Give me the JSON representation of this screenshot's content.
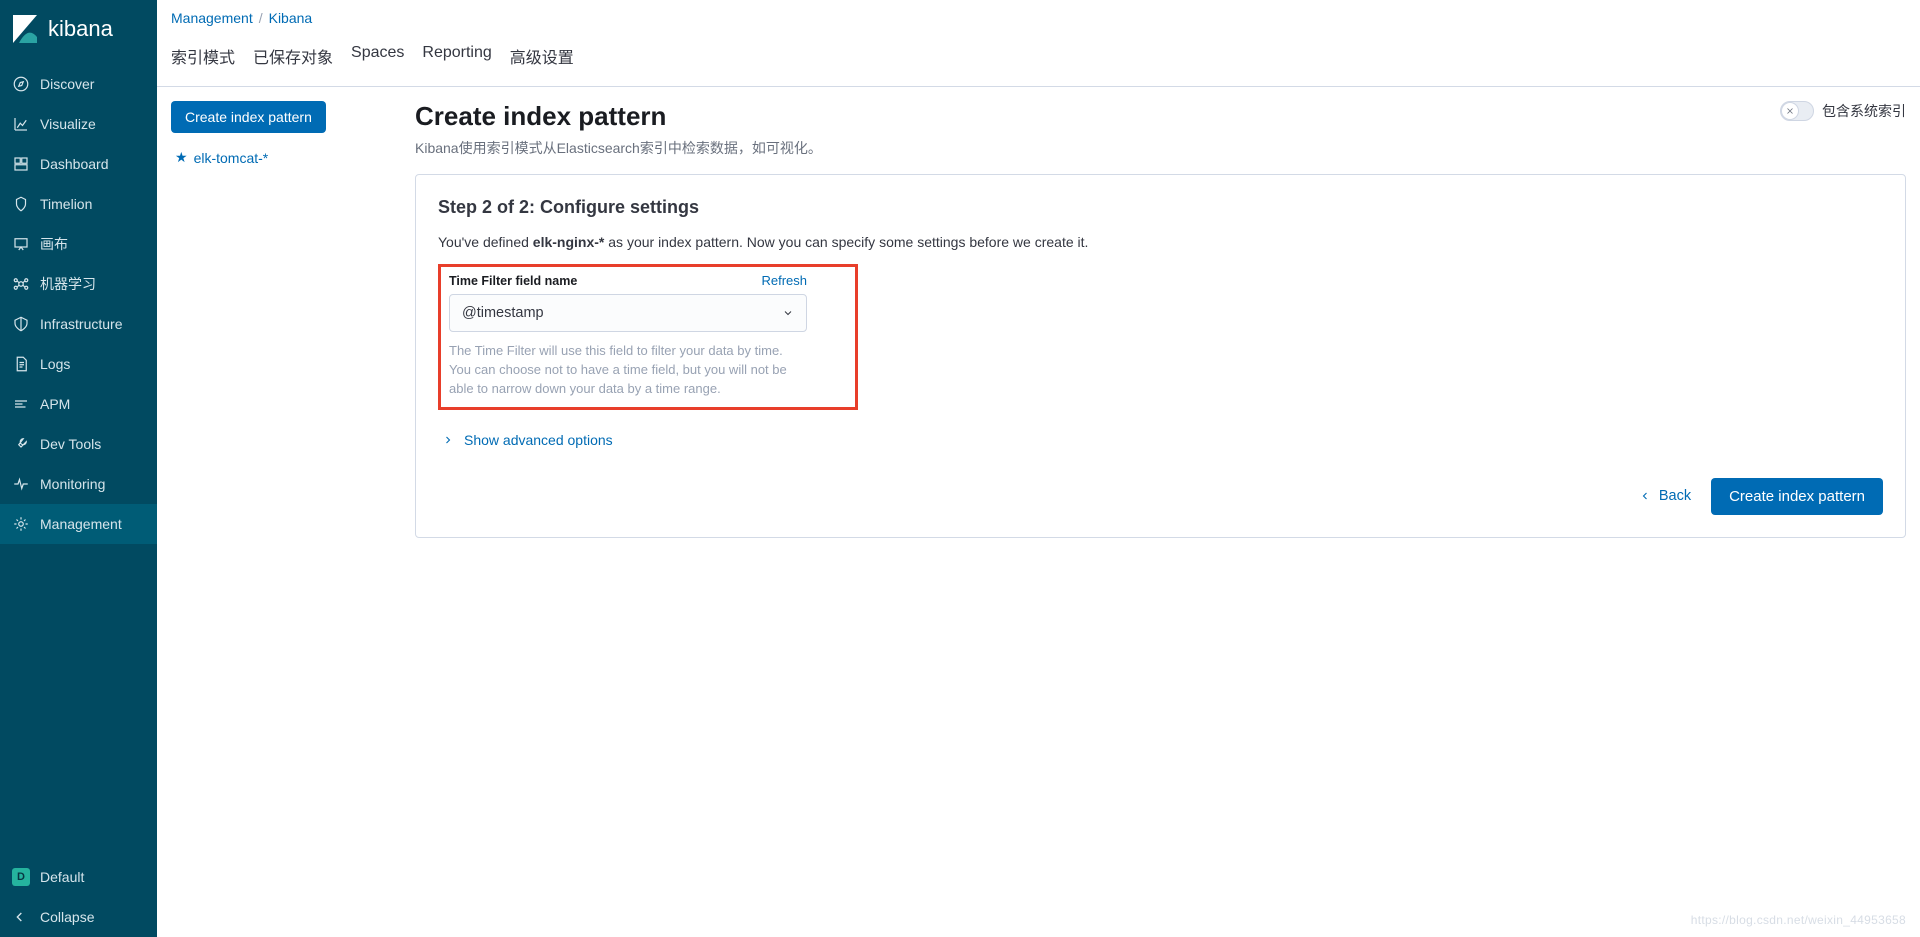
{
  "brand": "kibana",
  "sidebar_items": [
    {
      "key": "discover",
      "label": "Discover"
    },
    {
      "key": "visualize",
      "label": "Visualize"
    },
    {
      "key": "dashboard",
      "label": "Dashboard"
    },
    {
      "key": "timelion",
      "label": "Timelion"
    },
    {
      "key": "canvas",
      "label": "画布"
    },
    {
      "key": "ml",
      "label": "机器学习"
    },
    {
      "key": "infra",
      "label": "Infrastructure"
    },
    {
      "key": "logs",
      "label": "Logs"
    },
    {
      "key": "apm",
      "label": "APM"
    },
    {
      "key": "devtools",
      "label": "Dev Tools"
    },
    {
      "key": "monitoring",
      "label": "Monitoring"
    },
    {
      "key": "management",
      "label": "Management"
    }
  ],
  "sidebar_bottom": {
    "space_initial": "D",
    "space_name": "Default",
    "collapse": "Collapse"
  },
  "breadcrumbs": [
    "Management",
    "Kibana"
  ],
  "tabs": [
    "索引模式",
    "已保存对象",
    "Spaces",
    "Reporting",
    "高级设置"
  ],
  "left": {
    "create_btn": "Create index pattern",
    "patterns": [
      "elk-tomcat-*"
    ]
  },
  "page": {
    "title": "Create index pattern",
    "desc": "Kibana使用索引模式从Elasticsearch索引中检索数据，如可视化。",
    "toggle_label": "包含系统索引"
  },
  "panel": {
    "step_title": "Step 2 of 2: Configure settings",
    "lead_pre": "You've defined ",
    "lead_bold": "elk-nginx-*",
    "lead_post": " as your index pattern. Now you can specify some settings before we create it.",
    "field_label": "Time Filter field name",
    "refresh": "Refresh",
    "select_value": "@timestamp",
    "hint": "The Time Filter will use this field to filter your data by time.\nYou can choose not to have a time field, but you will not be able to narrow down your data by a time range.",
    "advanced": "Show advanced options",
    "back": "Back",
    "create": "Create index pattern"
  },
  "watermark": "https://blog.csdn.net/weixin_44953658"
}
